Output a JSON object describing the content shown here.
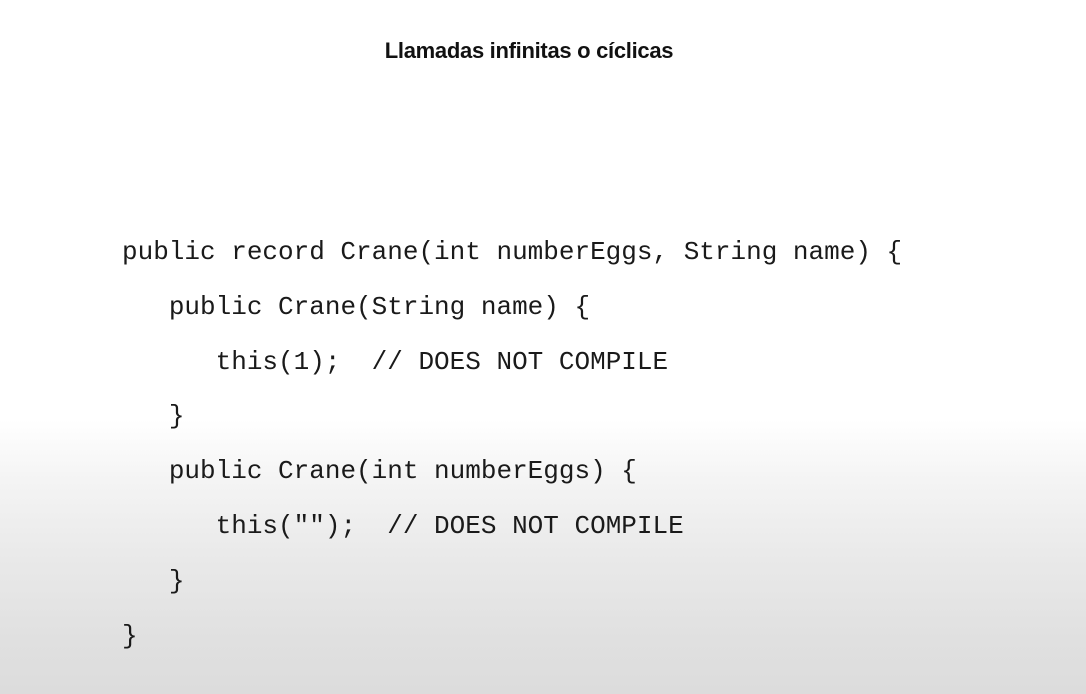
{
  "slide": {
    "title": "Llamadas infinitas o cíclicas",
    "code_lines": [
      {
        "indent": "",
        "text": "public record Crane(int numberEggs, String name) {"
      },
      {
        "indent": "   ",
        "text": "public Crane(String name) {"
      },
      {
        "indent": "      ",
        "text": "this(1);  // DOES NOT COMPILE"
      },
      {
        "indent": "   ",
        "text": "}"
      },
      {
        "indent": "   ",
        "text": "public Crane(int numberEggs) {"
      },
      {
        "indent": "      ",
        "text": "this(\"\");  // DOES NOT COMPILE"
      },
      {
        "indent": "   ",
        "text": "}"
      },
      {
        "indent": "",
        "text": "}"
      }
    ]
  }
}
